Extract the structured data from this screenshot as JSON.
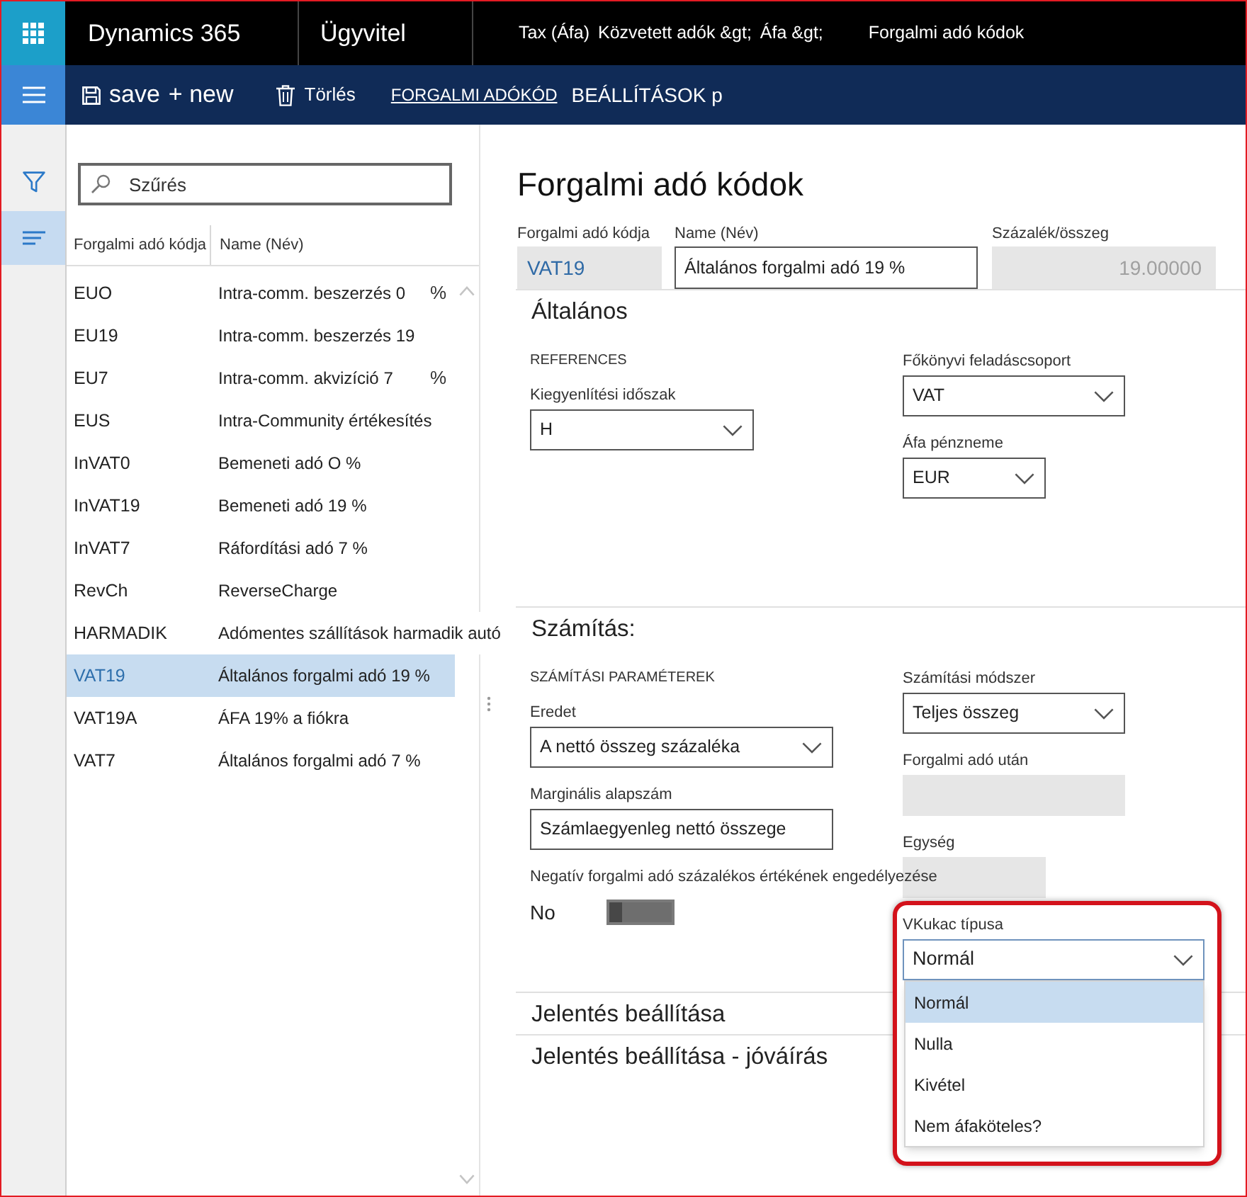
{
  "app_bar": {
    "app_name": "Dynamics 365",
    "module": "Ügyvitel",
    "breadcrumb": [
      "Tax (Áfa)",
      "Közvetett adók &gt;",
      "Áfa &gt;",
      "Forgalmi adó kódok"
    ]
  },
  "action_bar": {
    "actions": [
      {
        "kind": "save",
        "label": "save"
      },
      {
        "kind": "new",
        "label": "+ new"
      },
      {
        "kind": "delete",
        "label": "Törlés"
      },
      {
        "kind": "tab",
        "label": "FORGALMI ADÓKÓD"
      },
      {
        "kind": "menu",
        "label": "BEÁLLÍTÁSOK p"
      }
    ]
  },
  "side_nav": {
    "items": [
      {
        "kind": "filter",
        "selected": false
      },
      {
        "kind": "list",
        "selected": true
      }
    ]
  },
  "list": {
    "search": {
      "placeholder": "Szűrés"
    },
    "columns": [
      "Forgalmi adó kódja",
      "Name (Név)"
    ],
    "rows": [
      {
        "code": "EUO",
        "name": "Intra-comm. beszerzés 0",
        "suffix": "%",
        "selected": false
      },
      {
        "code": "EU19",
        "name": "Intra-comm. beszerzés 19",
        "selected": false
      },
      {
        "code": "EU7",
        "name": "Intra-comm. akvizíció 7",
        "suffix": "%",
        "selected": false
      },
      {
        "code": "EUS",
        "name": "Intra-Community értékesítés",
        "selected": false
      },
      {
        "code": "InVAT0",
        "name": "Bemeneti adó O %",
        "selected": false
      },
      {
        "code": "InVAT19",
        "name": "Bemeneti adó 19 %",
        "selected": false
      },
      {
        "code": "InVAT7",
        "name": "Ráfordítási adó 7 %",
        "selected": false
      },
      {
        "code": "RevCh",
        "name": "ReverseCharge",
        "selected": false
      },
      {
        "code": "HARMADIK",
        "name": "Adómentes szállítások harmadik autó",
        "selected": false
      },
      {
        "code": "VAT19",
        "name": "Általános forgalmi adó 19 %",
        "selected": true
      },
      {
        "code": "VAT19A",
        "name": "ÁFA 19% a fiókra",
        "selected": false
      },
      {
        "code": "VAT7",
        "name": "Általános forgalmi adó 7 %",
        "selected": false
      }
    ]
  },
  "form": {
    "title": "Forgalmi adó kódok",
    "header_fields": [
      {
        "kind": "readonly_code",
        "label": "Forgalmi adó kódja",
        "value": "VAT19"
      },
      {
        "kind": "text",
        "label": "Name (Név)",
        "value": "Általános forgalmi adó 19 %"
      },
      {
        "kind": "readonly_number",
        "label": "Százalék/összeg",
        "value": "19.00000"
      }
    ],
    "sections": [
      {
        "title": "Általános",
        "left_fields": [
          {
            "kind": "group_label",
            "text": "REFERENCES"
          },
          {
            "kind": "dropdown",
            "label": "Kiegyenlítési időszak",
            "value": "H"
          }
        ],
        "right_fields": [
          {
            "kind": "dropdown",
            "label": "Főkönyvi feladáscsoport",
            "value": "VAT"
          },
          {
            "kind": "dropdown",
            "label": "Áfa pénzneme",
            "value": "EUR"
          }
        ]
      },
      {
        "title": "Számítás:",
        "left_fields": [
          {
            "kind": "group_label",
            "text": "SZÁMÍTÁSI PARAMÉTEREK"
          },
          {
            "kind": "dropdown",
            "label": "Eredet",
            "value": "A nettó összeg százaléka"
          },
          {
            "kind": "text",
            "label": "Marginális alapszám",
            "value": "Számlaegyenleg nettó összege"
          },
          {
            "kind": "toggle",
            "label": "Negatív forgalmi adó százalékos értékének engedélyezése",
            "value": "No",
            "on": false
          }
        ],
        "right_fields": [
          {
            "kind": "dropdown",
            "label": "Számítási módszer",
            "value": "Teljes összeg"
          },
          {
            "kind": "readonly",
            "label": "Forgalmi adó után"
          },
          {
            "kind": "readonly",
            "label": "Egység"
          },
          {
            "kind": "dropdown_open",
            "label": "VKukac típusa",
            "value": "Normál",
            "options": [
              {
                "label": "Normál",
                "selected": true
              },
              {
                "label": "Nulla",
                "selected": false
              },
              {
                "label": "Kivétel",
                "selected": false
              },
              {
                "label": "Nem áfaköteles?",
                "selected": false
              }
            ]
          }
        ]
      },
      {
        "title": "Jelentés beállítása"
      },
      {
        "title": "Jelentés beállítása - jóváírás"
      }
    ]
  }
}
